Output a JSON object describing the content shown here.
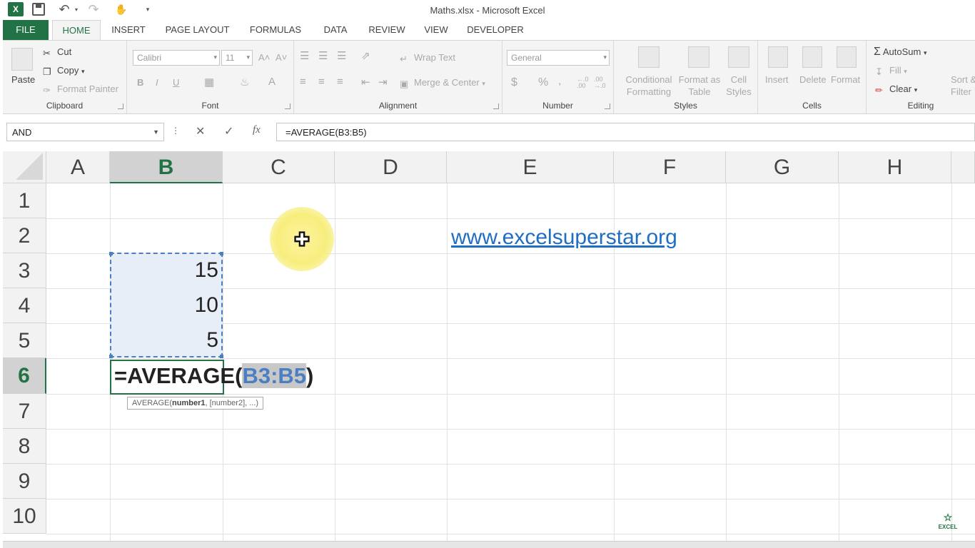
{
  "window": {
    "title": "Maths.xlsx - Microsoft Excel",
    "app_logo": "X"
  },
  "tabs": [
    "FILE",
    "HOME",
    "INSERT",
    "PAGE LAYOUT",
    "FORMULAS",
    "DATA",
    "REVIEW",
    "VIEW",
    "DEVELOPER"
  ],
  "active_tab": "HOME",
  "ribbon": {
    "clipboard": {
      "label": "Clipboard",
      "paste": "Paste",
      "cut": "Cut",
      "copy": "Copy",
      "format_painter": "Format Painter"
    },
    "font": {
      "label": "Font",
      "name": "Calibri",
      "size": "11",
      "grow": "A˄",
      "shrink": "A˅",
      "bold": "B",
      "italic": "I",
      "underline": "U"
    },
    "alignment": {
      "label": "Alignment",
      "wrap_text": "Wrap Text",
      "merge_center": "Merge & Center"
    },
    "number": {
      "label": "Number",
      "format": "General",
      "currency": "$",
      "percent": "%",
      "comma": ",",
      "inc_decimal": "←.0 .00",
      "dec_decimal": ".00 →.0"
    },
    "styles": {
      "label": "Styles",
      "conditional_1": "Conditional",
      "conditional_2": "Formatting",
      "format_table_1": "Format as",
      "format_table_2": "Table",
      "cell_styles_1": "Cell",
      "cell_styles_2": "Styles"
    },
    "cells": {
      "label": "Cells",
      "insert": "Insert",
      "delete": "Delete",
      "format": "Format"
    },
    "editing": {
      "label": "Editing",
      "autosum": "AutoSum",
      "fill": "Fill",
      "clear": "Clear",
      "sort_1": "Sort &",
      "sort_2": "Filter"
    }
  },
  "formula_bar": {
    "name_box": "AND",
    "cancel": "✕",
    "enter": "✓",
    "fx": "fx",
    "formula": "=AVERAGE(B3:B5)"
  },
  "columns": [
    "A",
    "B",
    "C",
    "D",
    "E",
    "F",
    "G",
    "H"
  ],
  "selected_column": "B",
  "rows": [
    "1",
    "2",
    "3",
    "4",
    "5",
    "6",
    "7",
    "8",
    "9",
    "10"
  ],
  "selected_row": "6",
  "cells": {
    "B3": "15",
    "B4": "10",
    "B5": "5"
  },
  "link_text": "www.excelsuperstar.org",
  "editing_cell": {
    "prefix": "=AVERAGE(",
    "ref": "B3:B5",
    "suffix": ")"
  },
  "tooltip": {
    "fn": "AVERAGE(",
    "arg1": "number1",
    "rest": ", [number2], ...)"
  },
  "watermark": "EXCEL"
}
